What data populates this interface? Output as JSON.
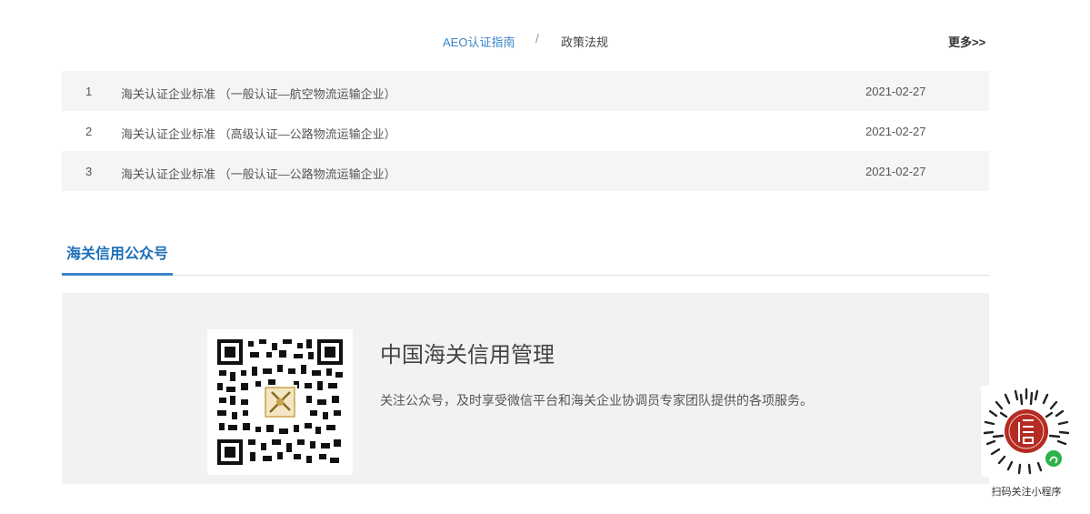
{
  "tabs": {
    "active_label": "AEO认证指南",
    "separator": "/",
    "second_label": "政策法规",
    "more_label": "更多>>"
  },
  "list": [
    {
      "index": "1",
      "title": "海关认证企业标准 （一般认证—航空物流运输企业）",
      "date": "2021-02-27"
    },
    {
      "index": "2",
      "title": "海关认证企业标准 （高级认证—公路物流运输企业）",
      "date": "2021-02-27"
    },
    {
      "index": "3",
      "title": "海关认证企业标准 （一般认证—公路物流运输企业）",
      "date": "2021-02-27"
    }
  ],
  "section": {
    "title": "海关信用公众号"
  },
  "panel": {
    "title": "中国海关信用管理",
    "description": "关注公众号，及时享受微信平台和海关企业协调员专家团队提供的各项服务。"
  },
  "mini_program": {
    "label": "扫码关注小程序"
  },
  "colors": {
    "accent": "#3a86c8",
    "section_title": "#1e6fb8",
    "row_shade": "#f5f5f5",
    "panel_bg": "#f2f2f2"
  }
}
